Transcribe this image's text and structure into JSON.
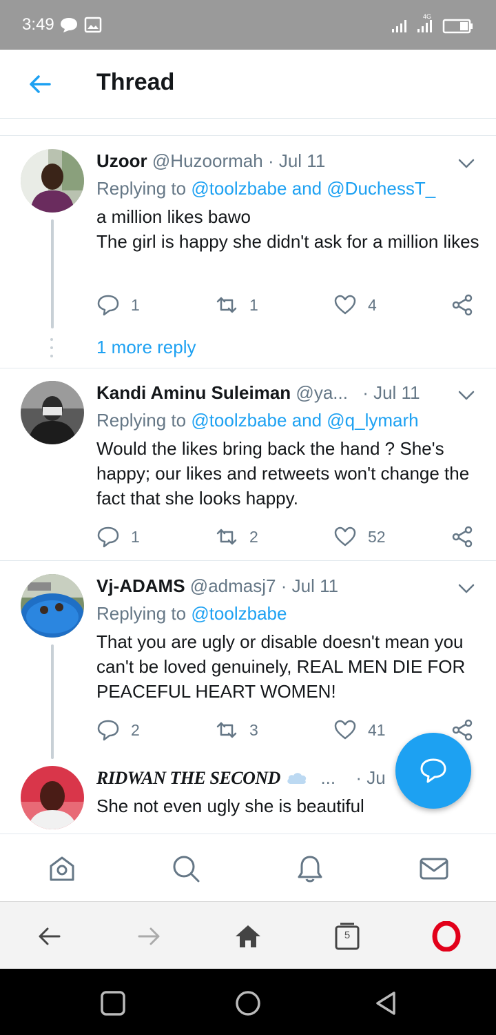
{
  "status_bar": {
    "time": "3:49",
    "network": "4G"
  },
  "header": {
    "title": "Thread"
  },
  "tweets": [
    {
      "name": "Uzoor",
      "handle": "@Huzoormah",
      "dot": "·",
      "date": "Jul 11",
      "replying_prefix": "Replying to ",
      "replying_to": "@toolzbabe and @DuchessT_",
      "text": "a million likes bawo\nThe girl is happy she didn't ask for a million likes",
      "replies": "1",
      "retweets": "1",
      "likes": "4",
      "more_replies": "1 more reply"
    },
    {
      "name": "Kandi Aminu Suleiman",
      "handle": "@ya...",
      "dot": "·",
      "date": "Jul 11",
      "replying_prefix": "Replying to ",
      "replying_to": "@toolzbabe and @q_lymarh",
      "text": "Would the likes bring back the hand ? She's happy; our likes and retweets won't change the fact that she looks happy.",
      "replies": "1",
      "retweets": "2",
      "likes": "52"
    },
    {
      "name": "Vj-ADAMS",
      "handle": "@admasj7",
      "dot": "·",
      "date": "Jul 11",
      "replying_prefix": "Replying to ",
      "replying_to": "@toolzbabe",
      "text": "That you are ugly or disable doesn't mean you can't be loved genuinely, REAL MEN DIE FOR PEACEFUL HEART WOMEN!",
      "replies": "2",
      "retweets": "3",
      "likes": "41"
    },
    {
      "name": "RIDWAN THE SECOND",
      "handle": "...",
      "dot": "·",
      "date": "Ju",
      "text": "She not even ugly she is beautiful"
    }
  ],
  "browser": {
    "tab_count": "5"
  },
  "colors": {
    "accent": "#1da1f2",
    "muted": "#657786",
    "opera": "#e2001a"
  },
  "icons": {
    "fab": "compose-reply-icon",
    "tabs": [
      "home-icon",
      "search-icon",
      "notifications-bell-icon",
      "messages-envelope-icon"
    ]
  }
}
